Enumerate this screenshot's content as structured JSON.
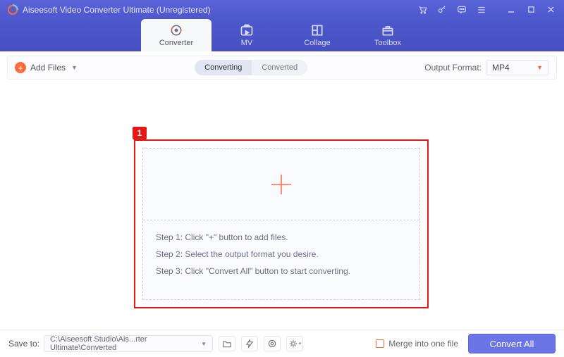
{
  "titlebar": {
    "title": "Aiseesoft Video Converter Ultimate (Unregistered)"
  },
  "tabs": {
    "converter": "Converter",
    "mv": "MV",
    "collage": "Collage",
    "toolbox": "Toolbox"
  },
  "toolbar": {
    "add_files": "Add Files",
    "seg_converting": "Converting",
    "seg_converted": "Converted",
    "output_format_label": "Output Format:",
    "output_format_value": "MP4"
  },
  "callout": {
    "number": "1"
  },
  "steps": {
    "s1": "Step 1: Click \"+\" button to add files.",
    "s2": "Step 2: Select the output format you desire.",
    "s3": "Step 3: Click \"Convert All\" button to start converting."
  },
  "bottom": {
    "save_to_label": "Save to:",
    "save_to_path": "C:\\Aiseesoft Studio\\Ais...rter Ultimate\\Converted",
    "merge_label": "Merge into one file",
    "convert_all": "Convert All"
  }
}
